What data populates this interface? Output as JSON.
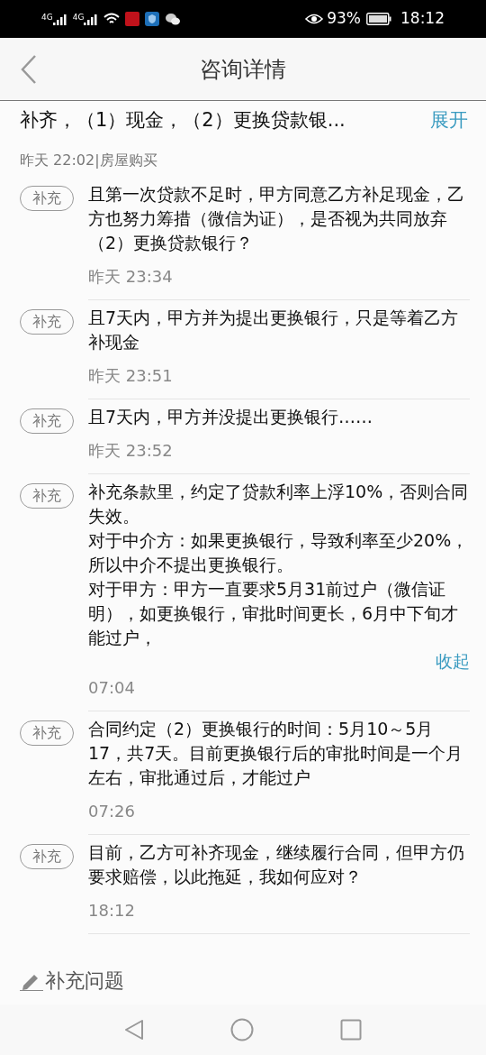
{
  "status_bar": {
    "signals": [
      "4G",
      "4G"
    ],
    "battery_percent": "93%",
    "time": "18:12"
  },
  "header": {
    "title": "咨询详情"
  },
  "question": {
    "title": "补齐，（1）现金，（2）更换贷款银...",
    "toggle": "展开",
    "meta": "昨天 22:02|房屋购买"
  },
  "entries": [
    {
      "tag": "补充",
      "text": "且第一次贷款不足时，甲方同意乙方补足现金，乙方也努力筹措（微信为证），是否视为共同放弃（2）更换贷款银行？",
      "time": "昨天 23:34"
    },
    {
      "tag": "补充",
      "text": "且7天内，甲方并为提出更换银行，只是等着乙方补现金",
      "time": "昨天 23:51"
    },
    {
      "tag": "补充",
      "text": "且7天内，甲方并没提出更换银行……",
      "time": "昨天 23:52"
    },
    {
      "tag": "补充",
      "text": "补充条款里，约定了贷款利率上浮10%，否则合同失效。",
      "more_paragraphs": [
        "对于中介方：如果更换银行，导致利率至少20%，所以中介不提出更换银行。",
        "对于甲方：甲方一直要求5月31前过户（微信证明），如更换银行，审批时间更长，6月中下旬才能过户，"
      ],
      "toggle": "收起",
      "time": "07:04"
    },
    {
      "tag": "补充",
      "text": "合同约定（2）更换银行的时间：5月10～5月17，共7天。目前更换银行后的审批时间是一个月左右，审批通过后，才能过户",
      "time": "07:26"
    },
    {
      "tag": "补充",
      "text": "目前，乙方可补齐现金，继续履行合同，但甲方仍要求赔偿，以此拖延，我如何应对？",
      "time": "18:12"
    }
  ],
  "add_question": {
    "label": "补充问题"
  }
}
